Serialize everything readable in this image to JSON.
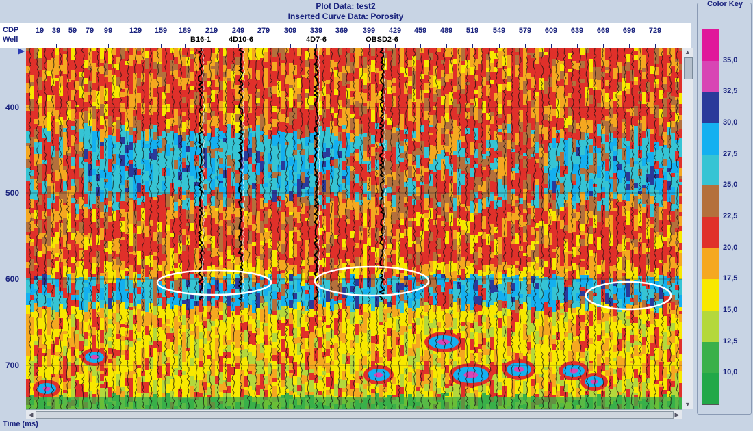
{
  "header": {
    "plot_data_line": "Plot Data: test2",
    "curve_data_line": "Inserted Curve Data:  Porosity",
    "cdp_label": "CDP",
    "well_label": "Well"
  },
  "cdp_ticks": [
    "19",
    "39",
    "59",
    "79",
    "99",
    "129",
    "159",
    "189",
    "219",
    "249",
    "279",
    "309",
    "339",
    "369",
    "399",
    "429",
    "459",
    "489",
    "519",
    "549",
    "579",
    "609",
    "639",
    "669",
    "699",
    "729"
  ],
  "wells": [
    "B16-1",
    "4D10-6",
    "4D7-6",
    "OBSD2-6"
  ],
  "time_ticks": [
    "400",
    "500",
    "600",
    "700"
  ],
  "time_axis_label": "Time (ms)",
  "color_key": {
    "title": "Color Key",
    "labels": [
      "35,0",
      "32,5",
      "30,0",
      "27,5",
      "25,0",
      "22,5",
      "20,0",
      "17,5",
      "15,0",
      "12,5",
      "10,0"
    ],
    "colors": [
      "#e0189a",
      "#d845b4",
      "#2a3a9a",
      "#14b0f0",
      "#36c4d4",
      "#b4703c",
      "#e0302a",
      "#f5a820",
      "#f8e800",
      "#b4d83c",
      "#3ab04a",
      "#22a848"
    ]
  },
  "highlights": [
    {
      "name": "highlight-ellipse-1"
    },
    {
      "name": "highlight-ellipse-2"
    },
    {
      "name": "highlight-ellipse-3"
    }
  ]
}
